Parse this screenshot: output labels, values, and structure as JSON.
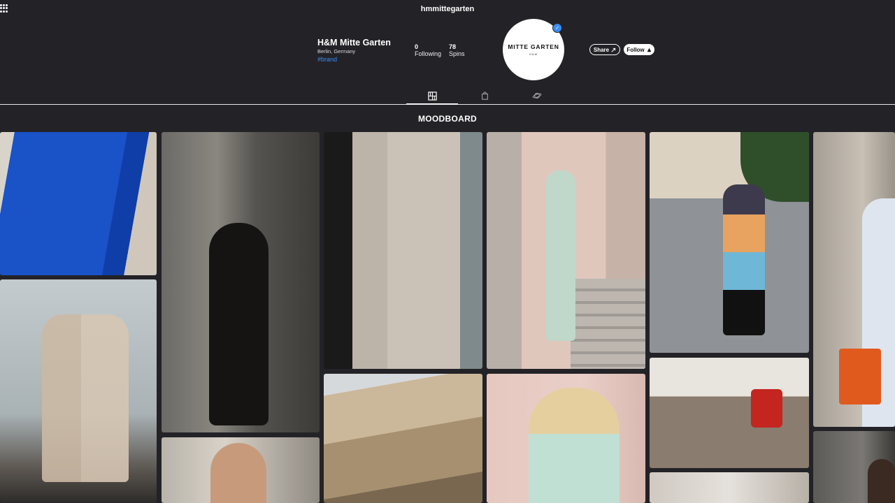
{
  "header": {
    "handle": "hmmittegarten"
  },
  "profile": {
    "name": "H&M Mitte Garten",
    "location": "Berlin, Germany",
    "tag": "#brand",
    "stats": [
      {
        "value": "0",
        "label": "Following"
      },
      {
        "value": "78",
        "label": "Spins"
      }
    ],
    "avatar_logo": "MITTE GARTEN",
    "avatar_sub": "H&M"
  },
  "actions": {
    "share_label": "Share",
    "follow_label": "Follow"
  },
  "tabs": [
    {
      "icon": "moodboard-grid-icon",
      "active": true
    },
    {
      "icon": "shopping-bag-icon",
      "active": false
    },
    {
      "icon": "planet-icon",
      "active": false
    }
  ],
  "section": {
    "title": "MOODBOARD"
  },
  "colors": {
    "background": "#232227",
    "accent": "#3a8ef6"
  },
  "moodboard": [
    {
      "desc": "blue graffiti jacket"
    },
    {
      "desc": "couple beige suits"
    },
    {
      "desc": "black leather dress street"
    },
    {
      "desc": "man portrait"
    },
    {
      "desc": "beige blazer detail"
    },
    {
      "desc": "ornate building facade"
    },
    {
      "desc": "mint suit on stairs"
    },
    {
      "desc": "blonde mint blazer"
    },
    {
      "desc": "colorful dress street crossing"
    },
    {
      "desc": "store interior love sign"
    },
    {
      "desc": "store facade mitte garten"
    },
    {
      "desc": "printed shirt orange clutch"
    },
    {
      "desc": "street portrait"
    }
  ]
}
